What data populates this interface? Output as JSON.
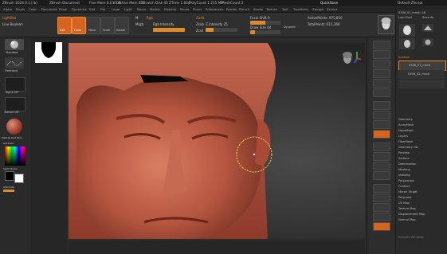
{
  "titlebar": {
    "app_title": "ZBrush 2024.0.1 [rb]",
    "doc": "ZBrush Document",
    "items": [
      "Free Mem 8.036GB",
      "Active Mem 807",
      "Scratch Disk 45",
      "ZTime 1.834",
      "PolyCount 1.215 MP",
      "MeshCount 2"
    ],
    "quicksave": "QuickSave",
    "right_label": "Default ZScript"
  },
  "menubar": {
    "items": [
      "Alpha",
      "Brush",
      "Color",
      "Document",
      "Draw",
      "Dynamics",
      "Edit",
      "File",
      "Layer",
      "Light",
      "Macro",
      "Marker",
      "Material",
      "Movie",
      "Picker",
      "Preferences",
      "Render",
      "Stencil",
      "Stroke",
      "Texture",
      "Tool",
      "Transform",
      "Zplugin",
      "Zscript"
    ]
  },
  "toolbar": {
    "tabs": [
      "LightBox",
      "Live Boolean"
    ],
    "mode_buttons": [
      "Edit",
      "Draw",
      "Move",
      "Scale",
      "Rotate"
    ],
    "zadd": "Zadd",
    "zsub": "Zsub",
    "zcut": "Zcut",
    "rgb": "Rgb",
    "mrgb": "Mrgb",
    "m": "M",
    "rgb_intensity_label": "Rgb Intensity",
    "z_intensity_label": "Z Intensity 25",
    "focal_shift_label": "Focal Shift 0",
    "draw_size_label": "Draw Size 64",
    "dynamic": "Dynamic",
    "active_points": "ActivePoints: 975,810",
    "total_points": "TotalPoints: 611,166"
  },
  "left": {
    "brush_label": "Standard",
    "stroke_label": "FreeHand",
    "alpha_label": "Alpha Off",
    "texture_label": "Texture Off",
    "material_label": "MatCap Red Wax",
    "gradient": "Gradient",
    "switch_color": "SwitchColor",
    "alternate": "Alternate"
  },
  "canvas": {
    "subject": "sculpted head"
  },
  "right_panel": {
    "tool_name": "0306_01_mesh: 48",
    "subtool_header": "Subtool",
    "items": [
      "0306_01_mesh",
      "0306_02_mesh"
    ],
    "buttons": [
      "Load Tool",
      "Save As",
      "Copy Tool",
      "Paste Tool",
      "Import",
      "Export",
      "Clone",
      "Make PolyMesh3D",
      "GoZ",
      "All",
      "Visible",
      "R"
    ],
    "sections": [
      "Geometry",
      "ArrayMesh",
      "NanoMesh",
      "Layers",
      "FiberMesh",
      "Geometry HD",
      "Preview",
      "Surface",
      "Deformation",
      "Masking",
      "Visibility",
      "Polygroups",
      "Contact",
      "Morph Target",
      "Polypaint",
      "UV Map",
      "Texture Map",
      "Displacement Map",
      "Normal Map"
    ],
    "watermark": "Activate Windows"
  },
  "colors": {
    "accent": "#e08a2e",
    "orange_button": "#d7641e",
    "skin": "#c0604a"
  }
}
